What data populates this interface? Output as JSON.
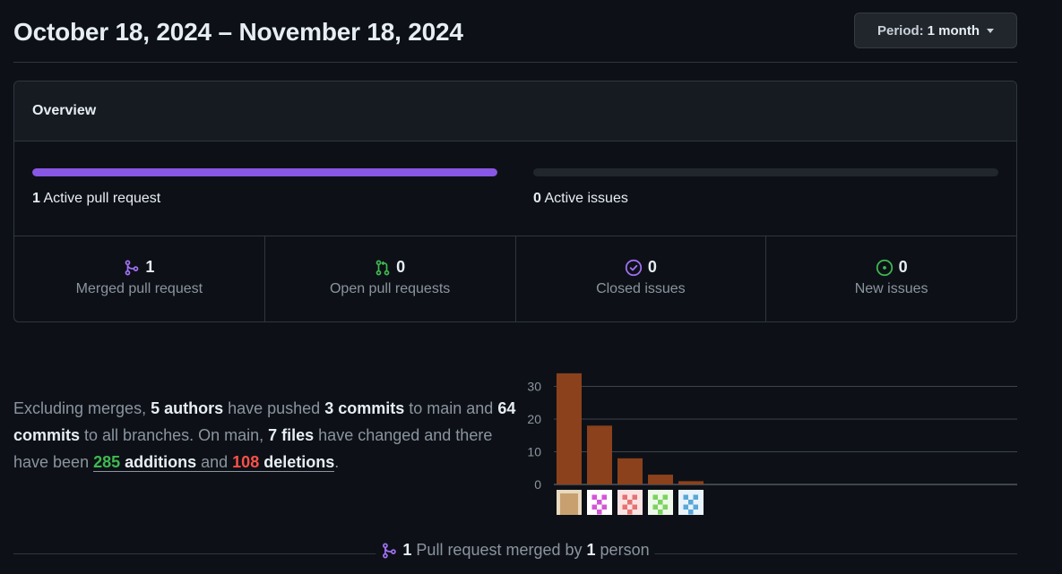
{
  "header": {
    "date_range": "October 18, 2024 – November 18, 2024",
    "period_label": "Period:",
    "period_value": "1 month"
  },
  "overview": {
    "title": "Overview",
    "active_prs": {
      "count": "1",
      "label": "Active pull request",
      "fill_fraction": 1.0,
      "color": "#8957e5"
    },
    "active_issues": {
      "count": "0",
      "label": "Active issues",
      "fill_fraction": 0.0
    },
    "stats": [
      {
        "icon": "git-merge-icon",
        "count": "1",
        "label": "Merged pull request",
        "color": "#a371f7"
      },
      {
        "icon": "git-pull-request-icon",
        "count": "0",
        "label": "Open pull requests",
        "color": "#3fb950"
      },
      {
        "icon": "issue-closed-icon",
        "count": "0",
        "label": "Closed issues",
        "color": "#a371f7"
      },
      {
        "icon": "issue-opened-icon",
        "count": "0",
        "label": "New issues",
        "color": "#3fb950"
      }
    ]
  },
  "summary": {
    "t1": "Excluding merges, ",
    "authors": "5 authors",
    "t2": " have pushed ",
    "commits_main": "3 commits",
    "t3": " to main and ",
    "commits_all": "64 commits",
    "t4": " to all branches. On main, ",
    "files": "7 files",
    "t5": " have changed and there have been ",
    "additions_num": "285",
    "additions_word": " additions",
    "t6": " and ",
    "deletions_num": "108",
    "deletions_word": " deletions",
    "t7": "."
  },
  "chart_data": {
    "type": "bar",
    "categories": [
      "author-1",
      "author-2",
      "author-3",
      "author-4",
      "author-5"
    ],
    "values": [
      34,
      18,
      8,
      3,
      1
    ],
    "yticks": [
      "0",
      "10",
      "20",
      "30"
    ],
    "ylim": [
      0,
      35
    ],
    "bar_color": "#8b411c",
    "grid": true
  },
  "footer": {
    "count": "1",
    "text1": " Pull request merged by ",
    "people": "1",
    "text2": " person"
  }
}
